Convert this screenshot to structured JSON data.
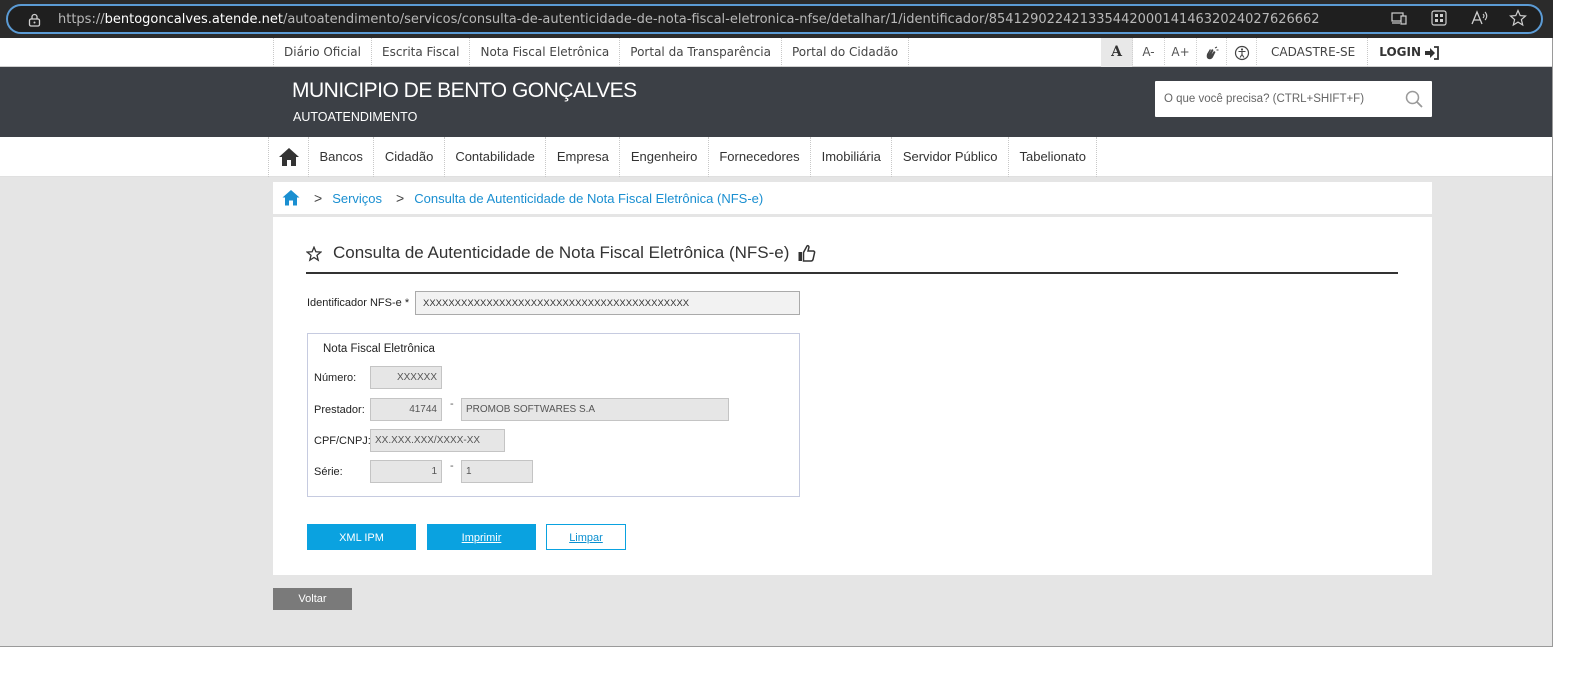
{
  "browser": {
    "url_prefix": "https://",
    "url_domain": "bentogoncalves.atende.net",
    "url_path": "/autoatendimento/servicos/consulta-de-autenticidade-de-nota-fiscal-eletronica-nfse/detalhar/1/identificador/854129022421335442000141463202402762666​2"
  },
  "util_bar": {
    "links": [
      "Diário Oficial",
      "Escrita Fiscal",
      "Nota Fiscal Eletrônica",
      "Portal da Transparência",
      "Portal do Cidadão"
    ],
    "font_normal": "A",
    "font_decrease": "A-",
    "font_increase": "A+",
    "register": "CADASTRE-SE",
    "login": "LOGIN"
  },
  "header": {
    "title": "MUNICIPIO DE BENTO GONÇALVES",
    "subtitle": "AUTOATENDIMENTO",
    "search_placeholder": "O que você precisa? (CTRL+SHIFT+F)"
  },
  "nav": {
    "items": [
      "Bancos",
      "Cidadão",
      "Contabilidade",
      "Empresa",
      "Engenheiro",
      "Fornecedores",
      "Imobiliária",
      "Servidor Público",
      "Tabelionato"
    ]
  },
  "breadcrumb": {
    "items": [
      "Serviços",
      "Consulta de Autenticidade de Nota Fiscal Eletrônica (NFS-e)"
    ]
  },
  "form": {
    "title": "Consulta de Autenticidade de Nota Fiscal Eletrônica (NFS-e)",
    "id_label": "Identificador NFS-e *",
    "id_value": "XXXXXXXXXXXXXXXXXXXXXXXXXXXXXXXXXXXXXXXXXX",
    "fieldset_title": "Nota Fiscal Eletrônica",
    "numero_label": "Número:",
    "numero_value": "XXXXXX",
    "prestador_label": "Prestador:",
    "prestador_code": "41744",
    "prestador_name": "PROMOB SOFTWARES S.A",
    "cpf_label": "CPF/CNPJ:",
    "cpf_value": "XX.XXX.XXX/XXXX-XX",
    "serie_label": "Série:",
    "serie_value_1": "1",
    "serie_value_2": "1",
    "separator": "-"
  },
  "buttons": {
    "xml": "XML IPM",
    "print": "Imprimir",
    "clear": "Limpar",
    "back": "Voltar"
  },
  "colors": {
    "accent": "#0aa2e0",
    "header_bg": "#3c4046",
    "link": "#1a8fd1"
  }
}
